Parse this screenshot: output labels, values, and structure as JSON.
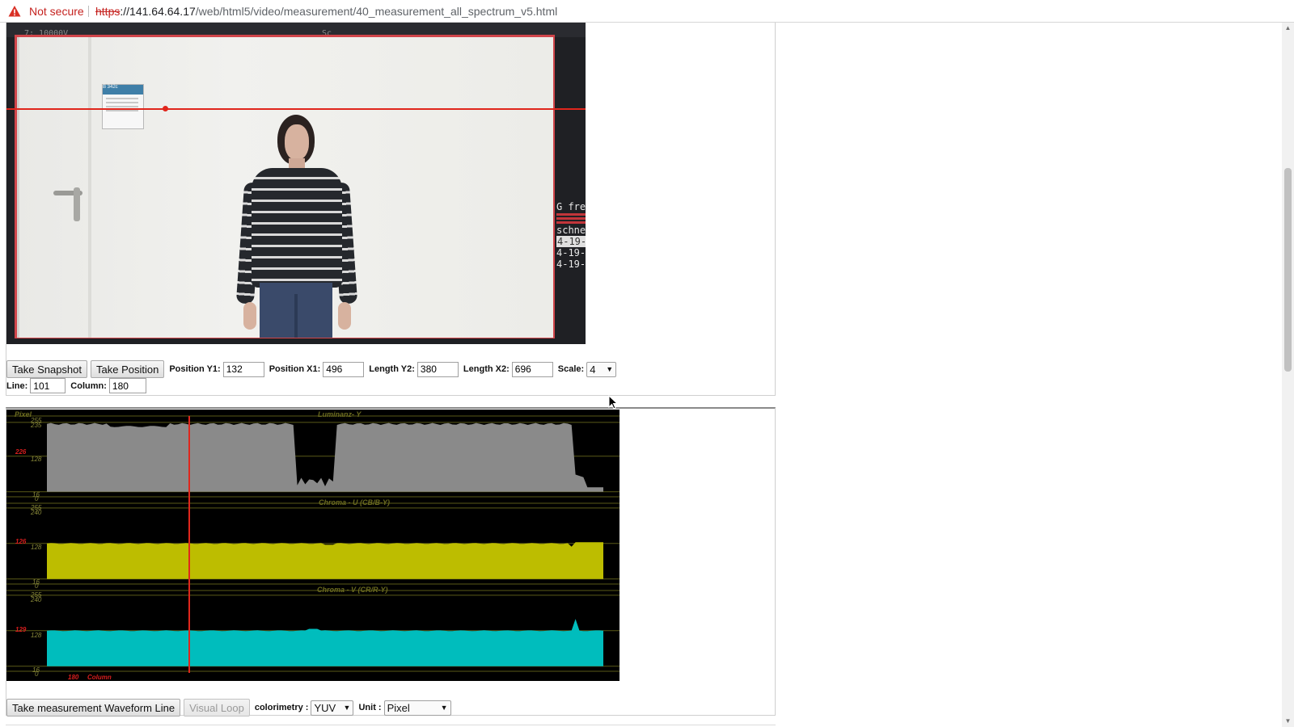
{
  "browser": {
    "security_label": "Not secure",
    "url_scheme": "https",
    "url_host": "://141.64.64.17",
    "url_path": "/web/html5/video/measurement/40_measurement_all_spectrum_v5.html"
  },
  "video_overlay": {
    "top_left_text": "7: 10000V",
    "top_mid_text": "Sc",
    "right_lines": [
      "G fre",
      "schne",
      "4-19-",
      "4-19-",
      "4-19-"
    ],
    "sign_text": "B 342c"
  },
  "controls": {
    "take_snapshot": "Take Snapshot",
    "take_position": "Take Position",
    "position_y1_label": "Position Y1:",
    "position_y1_value": "132",
    "position_x1_label": "Position X1:",
    "position_x1_value": "496",
    "length_y2_label": "Length Y2:",
    "length_y2_value": "380",
    "length_x2_label": "Length X2:",
    "length_x2_value": "696",
    "scale_label": "Scale:",
    "scale_value": "4",
    "line_label": "Line:",
    "line_value": "101",
    "column_label": "Column:",
    "column_value": "180"
  },
  "waveform": {
    "pixel_label": "Pixel",
    "column_label": "Column",
    "column_value": "180",
    "panels": [
      {
        "title": "Luminanz- Y",
        "current": "226",
        "ticks": [
          "255",
          "235",
          "128",
          "16",
          "0"
        ],
        "color": "#8a8a8a"
      },
      {
        "title": "Chroma - U (CB/B-Y)",
        "current": "126",
        "ticks": [
          "255",
          "240",
          "128",
          "16",
          "0"
        ],
        "color": "#bdbd00"
      },
      {
        "title": "Chroma - V (CR/R-Y)",
        "current": "129",
        "ticks": [
          "255",
          "240",
          "128",
          "16",
          "0"
        ],
        "color": "#00bdbd"
      }
    ]
  },
  "bottom_controls": {
    "take_waveform": "Take measurement Waveform Line",
    "visual_loop": "Visual Loop",
    "colorimetry_label": "colorimetry :",
    "colorimetry_value": "YUV",
    "unit_label": "Unit :",
    "unit_value": "Pixel"
  }
}
